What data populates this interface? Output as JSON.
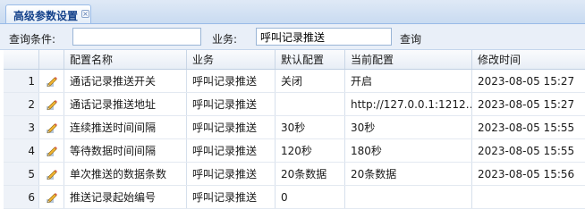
{
  "tab": {
    "title": "高级参数设置",
    "close_glyph": "×"
  },
  "query": {
    "condition_label": "查询条件:",
    "condition_value": "",
    "business_label": "业务:",
    "business_value": "呼叫记录推送",
    "search_label": "查询"
  },
  "grid": {
    "headers": {
      "name": "配置名称",
      "business": "业务",
      "default": "默认配置",
      "current": "当前配置",
      "modified": "修改时间"
    },
    "rows": [
      {
        "num": "1",
        "name": "通话记录推送开关",
        "business": "呼叫记录推送",
        "default": "关闭",
        "current": "开启",
        "modified": "2023-08-05 15:27"
      },
      {
        "num": "2",
        "name": "通话记录推送地址",
        "business": "呼叫记录推送",
        "default": "",
        "current": "http://127.0.0.1:1212…",
        "modified": "2023-08-05 15:27"
      },
      {
        "num": "3",
        "name": "连续推送时间间隔",
        "business": "呼叫记录推送",
        "default": "30秒",
        "current": "30秒",
        "modified": "2023-08-05 15:55"
      },
      {
        "num": "4",
        "name": "等待数据时间间隔",
        "business": "呼叫记录推送",
        "default": "120秒",
        "current": "180秒",
        "modified": "2023-08-05 15:55"
      },
      {
        "num": "5",
        "name": "单次推送的数据条数",
        "business": "呼叫记录推送",
        "default": "20条数据",
        "current": "20条数据",
        "modified": "2023-08-05 15:56"
      },
      {
        "num": "6",
        "name": "推送记录起始编号",
        "business": "呼叫记录推送",
        "default": "0",
        "current": "",
        "modified": ""
      }
    ]
  }
}
